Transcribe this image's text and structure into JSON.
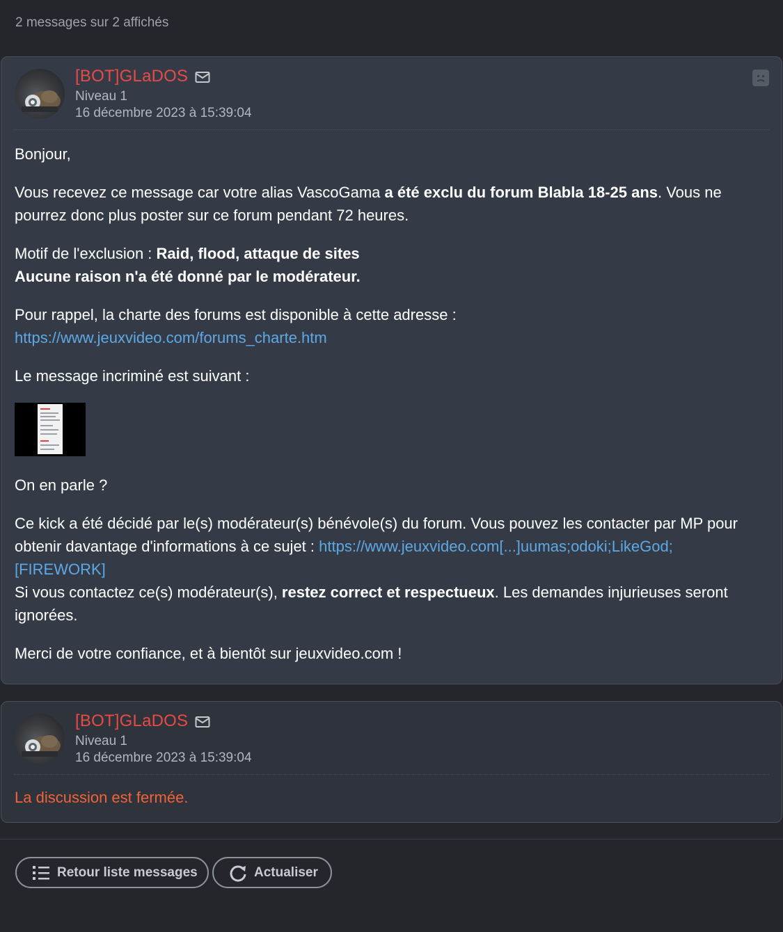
{
  "count_text": "2 messages sur 2 affichés",
  "colors": {
    "background": "#24262b",
    "card": "#353b46",
    "author": "#e84b47",
    "link": "#5da9e6",
    "closed": "#f0633a"
  },
  "messages": [
    {
      "author": "[BOT]GLaDOS",
      "level": "Niveau 1",
      "date": "16 décembre 2023 à 15:39:04",
      "icons": [
        "mail-icon",
        "sad-face-icon"
      ],
      "body": {
        "greeting": "Bonjour,",
        "p1_a": "Vous recevez ce message car votre alias VascoGama ",
        "p1_bold": "a été exclu du forum Blabla 18-25 ans",
        "p1_b": ". Vous ne pourrez donc plus poster sur ce forum pendant 72 heures.",
        "reason_label": "Motif de l'exclusion : ",
        "reason_value": "Raid, flood, attaque de sites",
        "no_reason": "Aucune raison n'a été donné par le modérateur.",
        "charter_text": "Pour rappel, la charte des forums est disponible à cette adresse :",
        "charter_link": "https://www.jeuxvideo.com/forums_charte.htm",
        "incriminated": "Le message incriminé est suivant :",
        "discuss": "On en parle ?",
        "kick_a": "Ce kick a été décidé par le(s) modérateur(s) bénévole(s) du forum. Vous pouvez les contacter par MP pour obtenir davantage d'informations à ce sujet : ",
        "kick_link": "https://www.jeuxvideo.com[...]uumas;odoki;LikeGod;[FIREWORK]",
        "contact_a": "Si vous contactez ce(s) modérateur(s), ",
        "contact_bold": "restez correct et respectueux",
        "contact_b": ". Les demandes injurieuses seront ignorées.",
        "thanks": "Merci de votre confiance, et à bientôt sur jeuxvideo.com !"
      }
    },
    {
      "author": "[BOT]GLaDOS",
      "level": "Niveau 1",
      "date": "16 décembre 2023 à 15:39:04",
      "icons": [
        "mail-icon"
      ],
      "closed_text": "La discussion est fermée."
    }
  ],
  "buttons": {
    "back_label": "Retour liste messages",
    "back_icon": "list-icon",
    "refresh_label": "Actualiser",
    "refresh_icon": "refresh-icon"
  }
}
